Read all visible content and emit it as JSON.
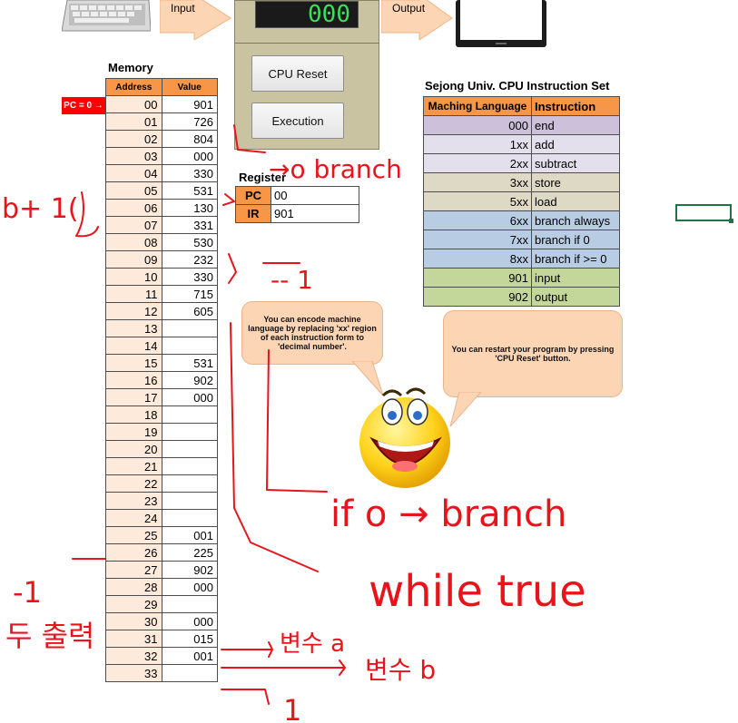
{
  "top": {
    "input_label": "Input",
    "output_label": "Output",
    "display_value": "000",
    "cpu_reset_label": "CPU Reset",
    "execution_label": "Execution"
  },
  "memory": {
    "title": "Memory",
    "headers": [
      "Address",
      "Value"
    ],
    "pc_marker": "PC = 0 →",
    "rows": [
      {
        "addr": "00",
        "val": "901"
      },
      {
        "addr": "01",
        "val": "726"
      },
      {
        "addr": "02",
        "val": "804"
      },
      {
        "addr": "03",
        "val": "000"
      },
      {
        "addr": "04",
        "val": "330"
      },
      {
        "addr": "05",
        "val": "531"
      },
      {
        "addr": "06",
        "val": "130"
      },
      {
        "addr": "07",
        "val": "331"
      },
      {
        "addr": "08",
        "val": "530"
      },
      {
        "addr": "09",
        "val": "232"
      },
      {
        "addr": "10",
        "val": "330"
      },
      {
        "addr": "11",
        "val": "715"
      },
      {
        "addr": "12",
        "val": "605"
      },
      {
        "addr": "13",
        "val": ""
      },
      {
        "addr": "14",
        "val": ""
      },
      {
        "addr": "15",
        "val": "531"
      },
      {
        "addr": "16",
        "val": "902"
      },
      {
        "addr": "17",
        "val": "000"
      },
      {
        "addr": "18",
        "val": ""
      },
      {
        "addr": "19",
        "val": ""
      },
      {
        "addr": "20",
        "val": ""
      },
      {
        "addr": "21",
        "val": ""
      },
      {
        "addr": "22",
        "val": ""
      },
      {
        "addr": "23",
        "val": ""
      },
      {
        "addr": "24",
        "val": ""
      },
      {
        "addr": "25",
        "val": "001"
      },
      {
        "addr": "26",
        "val": "225"
      },
      {
        "addr": "27",
        "val": "902"
      },
      {
        "addr": "28",
        "val": "000"
      },
      {
        "addr": "29",
        "val": ""
      },
      {
        "addr": "30",
        "val": "000"
      },
      {
        "addr": "31",
        "val": "015"
      },
      {
        "addr": "32",
        "val": "001"
      },
      {
        "addr": "33",
        "val": ""
      }
    ]
  },
  "register": {
    "title": "Register",
    "rows": [
      {
        "key": "PC",
        "val": "00"
      },
      {
        "key": "IR",
        "val": "901"
      }
    ]
  },
  "instruction_set": {
    "title": "Sejong Univ. CPU Instruction Set",
    "headers": [
      "Maching Language",
      "Instruction"
    ],
    "rows": [
      {
        "code": "000",
        "instr": "end",
        "color": "#ccc0da"
      },
      {
        "code": "1xx",
        "instr": "add",
        "color": "#e4dfec"
      },
      {
        "code": "2xx",
        "instr": "subtract",
        "color": "#e4dfec"
      },
      {
        "code": "3xx",
        "instr": "store",
        "color": "#ddd9c4"
      },
      {
        "code": "5xx",
        "instr": "load",
        "color": "#ddd9c4"
      },
      {
        "code": "6xx",
        "instr": "branch always",
        "color": "#b8cce4"
      },
      {
        "code": "7xx",
        "instr": "branch if 0",
        "color": "#b8cce4"
      },
      {
        "code": "8xx",
        "instr": "branch if >= 0",
        "color": "#b8cce4"
      },
      {
        "code": "901",
        "instr": "input",
        "color": "#c4d79b"
      },
      {
        "code": "902",
        "instr": "output",
        "color": "#c4d79b"
      }
    ]
  },
  "bubbles": {
    "encode_tip": "You can encode machine language by replacing 'xx' region of each instruction form to 'decimal number'.",
    "restart_tip": "You can restart your program by pressing 'CPU Reset' button."
  },
  "handwriting": {
    "branch_note": "→o branch",
    "b_note": "b+ 1(",
    "minus_one": "-- 1",
    "if_zero": "if o → branch",
    "while_true": "while true",
    "minus_one_left": "-1",
    "print_note": "두 출력",
    "var_a": "변수 a",
    "var_b": "변수 b",
    "one": "1"
  },
  "colors": {
    "header_orange": "#f79646",
    "address_fill": "#fdeada",
    "pc_red": "#ff0000",
    "lcd_green": "#39e05a",
    "ink_red": "#e8141c"
  }
}
